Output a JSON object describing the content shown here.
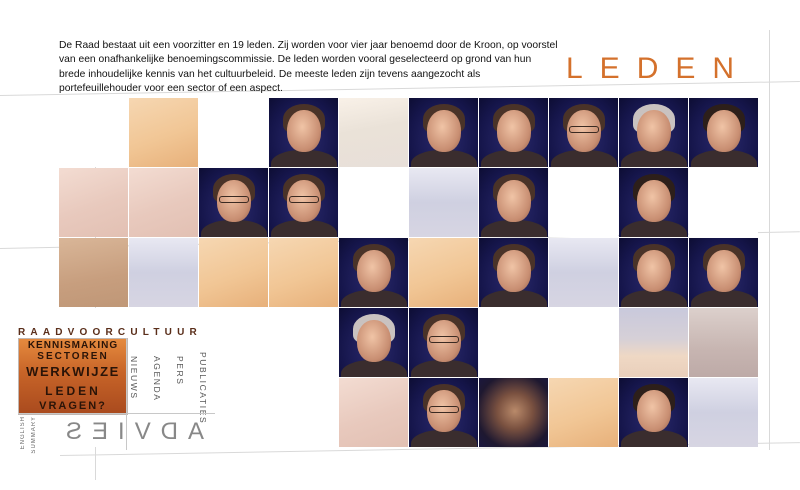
{
  "intro_text": "De Raad bestaat uit een voorzitter en 19 leden. Zij worden voor vier jaar benoemd door de Kroon, op voorstel van een onafhankelijke benoemingscommissie. De leden worden vooral geselecteerd op grond van hun brede inhoudelijke kennis van het cultuurbeleid. De meeste leden zijn tevens aangezocht als portefeuillehouder voor een sector of een aspect.",
  "page_title": "LEDEN",
  "colors": {
    "accent": "#d4712c",
    "menu_orange": "#c76428"
  },
  "nav": {
    "brand": "RAADVOORCULTUUR",
    "main": [
      "KENNISMAKING",
      "SECTOREN",
      "WERKWIJZE",
      "LEDEN",
      "VRAGEN?"
    ],
    "side": [
      "NIEUWS",
      "AGENDA",
      "PERS",
      "PUBLICATIES"
    ],
    "languages": [
      "ENGLISH",
      "SUMMARY"
    ],
    "footer": "ADVIES"
  },
  "grid": {
    "rows": [
      [
        "blank",
        "peach",
        "blank",
        "photo-man",
        "cream",
        "photo-woman",
        "photo-woman",
        "photo-man-glasses",
        "photo-man-grey",
        "photo-woman-dark"
      ],
      [
        "rose",
        "rose",
        "photo-man-glasses",
        "photo-man-glasses",
        "blank",
        "lilac",
        "photo-woman",
        "blank",
        "photo-woman-dark",
        "blank"
      ],
      [
        "tan",
        "lilac",
        "peach",
        "peach",
        "photo-woman",
        "peach",
        "photo-man",
        "lilac",
        "photo-woman",
        "photo-woman"
      ],
      [
        "blank",
        "blank",
        "blank",
        "blank",
        "photo-man-grey",
        "photo-man-glasses",
        "blank",
        "blank",
        "sky",
        "mauve"
      ],
      [
        "blank",
        "blank",
        "blank",
        "blank",
        "rose",
        "photo-woman-glasses",
        "blur",
        "peach",
        "photo-woman-dark",
        "lilac"
      ]
    ]
  }
}
